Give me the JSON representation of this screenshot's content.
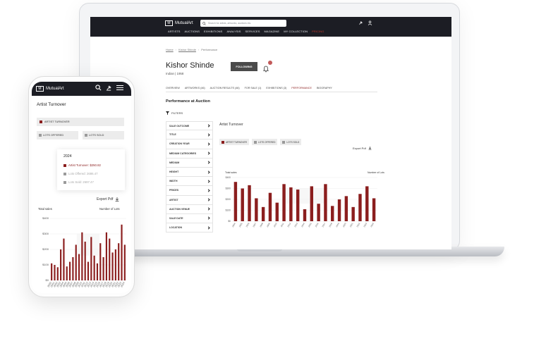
{
  "desktop": {
    "logo": "MutualArt",
    "search_placeholder": "Search for artists, artworks, auctions etc.",
    "nav": [
      "ARTISTS",
      "AUCTIONS",
      "EXHIBITIONS",
      "ANALYSIS",
      "SERVICES",
      "MAGAZINE",
      "MY COLLECTION",
      "PRICING"
    ],
    "nav_active": "PRICING",
    "breadcrumb": [
      "Home",
      "Kishor Shinde",
      "Performance"
    ],
    "artist_name": "Kishor Shinde",
    "artist_meta": "Indian | 1958",
    "follow_label": "FOLLOWING",
    "tabs": [
      "OVERVIEW",
      "ARTWORKS (46)",
      "AUCTION RESULTS (46)",
      "FOR SALE (1)",
      "EXHIBITIONS (3)",
      "PERFORMANCE",
      "BIOGRAPHY"
    ],
    "active_tab": "PERFORMANCE",
    "section_title": "Performance at Auction",
    "filters_label": "FILTERS",
    "filters": [
      "SALE OUTCOME",
      "TITLE",
      "CREATION YEAR",
      "MEDIUM CATEGORIES",
      "MEDIUM",
      "HEIGHT",
      "WIDTH",
      "PRICES",
      "ARTIST",
      "AUCTION VENUE",
      "SALE DATE",
      "LOCATION"
    ],
    "turnover_title": "Artist Turnover",
    "legend": [
      "ARTIST TURNOVER",
      "LOTS OFFERED",
      "LOTS SOLD"
    ],
    "export_label": "Export Pdf",
    "axis_left": "Total sales",
    "axis_right": "Number of Lots"
  },
  "mobile": {
    "logo": "MutualArt",
    "title": "Artist Turnover",
    "legend_selected": "ARTIST TURNOVER",
    "legend_other": [
      "LOTS OFFERED",
      "LOTS SOLD"
    ],
    "tooltip_year": "2024",
    "tooltip_lines": [
      "Artist Turnover: $250.82",
      "Lots Offered: 2686.47",
      "Lots Sold: 2697.47"
    ],
    "export_label": "Export Pdf",
    "axis_left": "Total sales",
    "axis_right": "Number of Lots"
  },
  "colors": {
    "accent": "#8b1e1e",
    "topbar": "#1c1d24",
    "nav_active": "#c0392b"
  },
  "chart_data": [
    {
      "type": "bar",
      "title": "Artist Turnover",
      "xlabel": "",
      "ylabel": "Total sales",
      "y_ticks": [
        "$0",
        "$100",
        "$200",
        "$300",
        "$400"
      ],
      "categories": [
        "2004",
        "2005",
        "2006",
        "2007",
        "2008",
        "2009",
        "2010",
        "2011",
        "2012",
        "2013",
        "2014",
        "2015",
        "2016",
        "2017",
        "2018",
        "2019",
        "2020",
        "2021",
        "2022",
        "2023",
        "2024"
      ],
      "values": [
        360,
        300,
        330,
        210,
        130,
        260,
        170,
        340,
        310,
        290,
        110,
        320,
        160,
        340,
        140,
        200,
        230,
        130,
        250,
        320,
        210
      ],
      "ylim": [
        0,
        400
      ]
    },
    {
      "type": "bar",
      "title": "Artist Turnover",
      "ylabel": "Total sales",
      "y_ticks": [
        "$0",
        "$100",
        "$200",
        "$300",
        "$400"
      ],
      "categories": [
        "2000",
        "2001",
        "2002",
        "2003",
        "2004",
        "2005",
        "2006",
        "2007",
        "2008",
        "2009",
        "2010",
        "2011",
        "2012",
        "2013",
        "2014",
        "2015",
        "2016",
        "2017",
        "2018",
        "2019",
        "2020",
        "2021",
        "2022",
        "2023",
        "2024"
      ],
      "values": [
        110,
        100,
        85,
        200,
        270,
        90,
        120,
        150,
        230,
        170,
        310,
        250,
        120,
        280,
        160,
        110,
        240,
        150,
        310,
        270,
        180,
        200,
        240,
        360,
        230
      ],
      "ylim": [
        0,
        400
      ]
    }
  ]
}
